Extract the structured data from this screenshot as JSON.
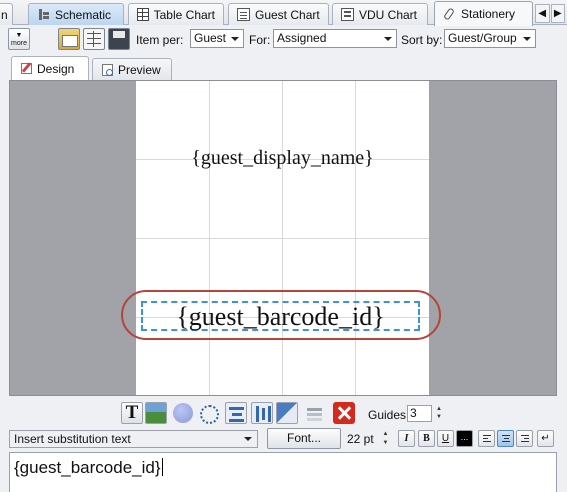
{
  "tabs": [
    {
      "label": "n",
      "icon": ""
    },
    {
      "label": "Schematic",
      "icon": "schematic-icon"
    },
    {
      "label": "Table Chart",
      "icon": "table-icon"
    },
    {
      "label": "Guest Chart",
      "icon": "guest-list-icon"
    },
    {
      "label": "VDU Chart",
      "icon": "vdu-icon"
    },
    {
      "label": "Stationery",
      "icon": "pen-icon"
    }
  ],
  "tab_arrows": {
    "left": "◀",
    "right": "▶"
  },
  "toolbar": {
    "more_label": "more",
    "item_per_label": "Item per:",
    "item_per_value": "Guest",
    "for_label": "For:",
    "for_value": "Assigned",
    "sort_by_label": "Sort by:",
    "sort_by_value": "Guest/Group"
  },
  "subtabs": {
    "design": "Design",
    "preview": "Preview"
  },
  "canvas": {
    "field_1": "{guest_display_name}",
    "field_2": "{guest_barcode_id}",
    "highlight_color": "#b5453a",
    "selection_color": "#3a93dd"
  },
  "bottom_tools": {
    "text_tool": "T",
    "guides_label": "Guides:",
    "guides_value": "3"
  },
  "format": {
    "substitution_placeholder": "Insert substitution text",
    "font_button": "Font...",
    "font_size": "22 pt",
    "italic": "I",
    "bold": "B",
    "underline": "U",
    "color_button": "..."
  },
  "editor": {
    "text": "{guest_barcode_id}"
  }
}
